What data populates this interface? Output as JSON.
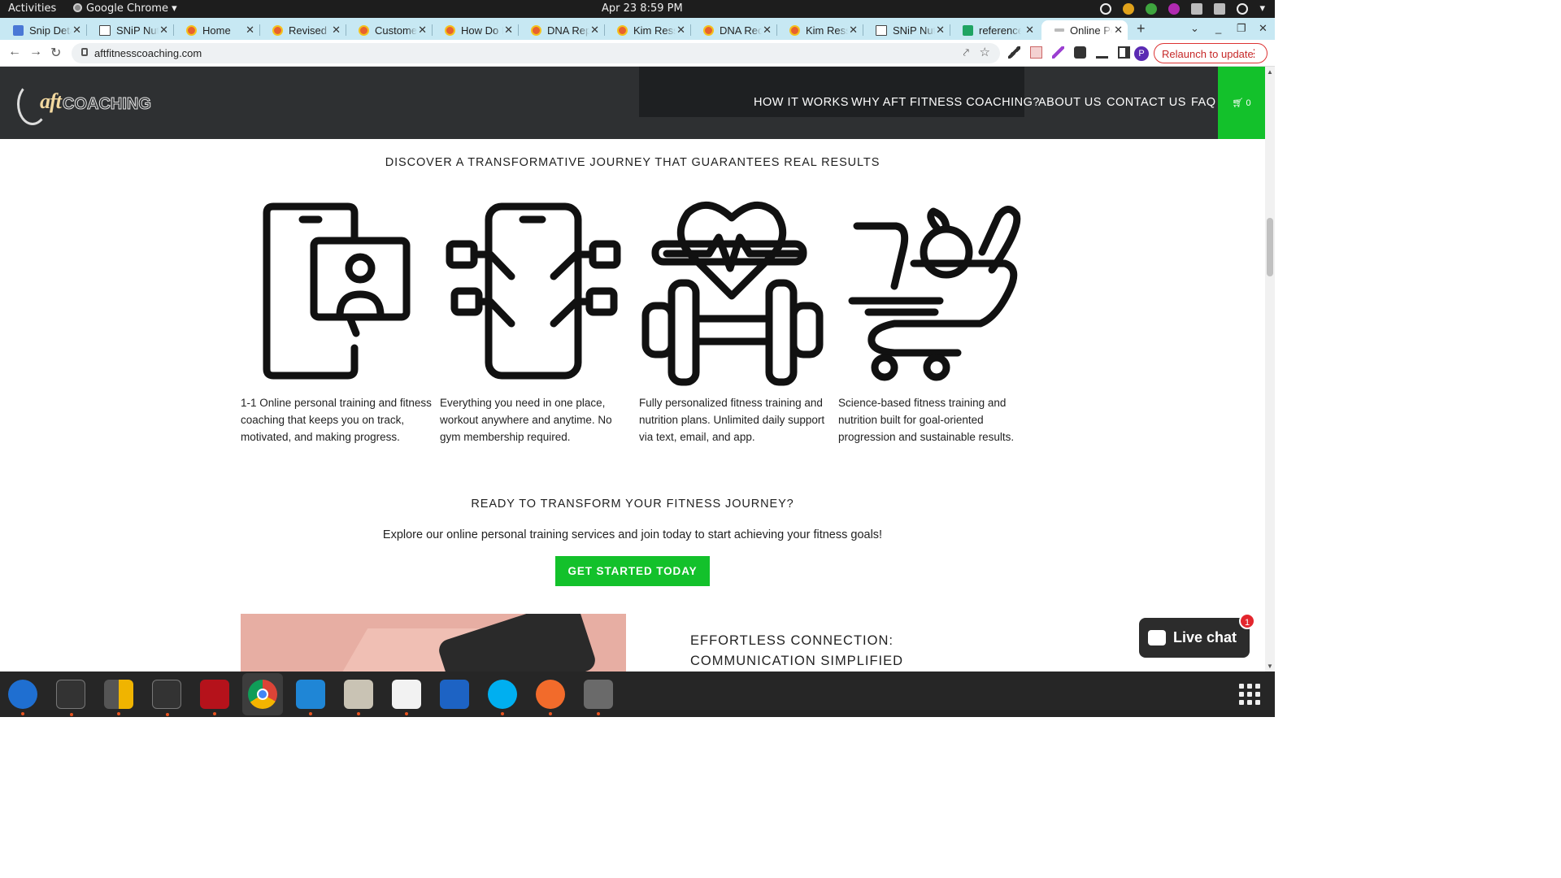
{
  "os": {
    "activities": "Activities",
    "app_name": "Google Chrome",
    "clock": "Apr 23  8:59 PM"
  },
  "tabs": [
    {
      "label": "Snip Details",
      "icon": "doc"
    },
    {
      "label": "SNiP Nutrition",
      "icon": "snip"
    },
    {
      "label": "Home",
      "icon": "site"
    },
    {
      "label": "Revised S",
      "icon": "site"
    },
    {
      "label": "Customer",
      "icon": "site"
    },
    {
      "label": "How Do D",
      "icon": "site"
    },
    {
      "label": "DNA Report",
      "icon": "site"
    },
    {
      "label": "Kim Ressler",
      "icon": "site"
    },
    {
      "label": "DNA Rece",
      "icon": "site"
    },
    {
      "label": "Kim Ressl",
      "icon": "site"
    },
    {
      "label": "SNiP Nutr",
      "icon": "snip"
    },
    {
      "label": "reference",
      "icon": "sheet"
    },
    {
      "label": "Online Pe",
      "icon": "gray",
      "active": true
    }
  ],
  "browser": {
    "url": "aftfitnesscoaching.com",
    "avatar_initial": "P",
    "relaunch_label": "Relaunch to update"
  },
  "site": {
    "logo_aft": "aft",
    "logo_coaching": "COACHING",
    "menu": [
      "HOW IT WORKS",
      "WHY AFT FITNESS COACHING?",
      "ABOUT US",
      "CONTACT US",
      "FAQ"
    ],
    "cart_count": "0"
  },
  "content": {
    "discover_heading": "DISCOVER A TRANSFORMATIVE JOURNEY THAT GUARANTEES REAL RESULTS",
    "features": [
      {
        "icon": "phone-video-coach-icon",
        "text": "1-1 Online personal training and fitness coaching that keeps you on track, motivated, and making progress."
      },
      {
        "icon": "phone-connect-icon",
        "text": "Everything you need in one place, workout anywhere and anytime. No gym membership required."
      },
      {
        "icon": "heart-dumbbell-icon",
        "text": "Fully personalized fitness training and nutrition plans. Unlimited daily support via text, email, and app."
      },
      {
        "icon": "grocery-cart-icon",
        "text": "Science-based fitness training and nutrition built for goal-oriented progression and sustainable results."
      }
    ],
    "ready_heading": "READY TO TRANSFORM YOUR FITNESS JOURNEY?",
    "explore_text": "Explore our online personal training services and join today to start achieving your fitness goals!",
    "cta_label": "GET STARTED TODAY",
    "effortless_line1": "EFFORTLESS CONNECTION:",
    "effortless_line2": "COMMUNICATION SIMPLIFIED"
  },
  "chat": {
    "label": "Live chat",
    "badge": "1"
  },
  "colors": {
    "brand_green": "#13c12b",
    "header_bg": "#2e3032",
    "tabstrip_bg": "#c7e8f3"
  }
}
